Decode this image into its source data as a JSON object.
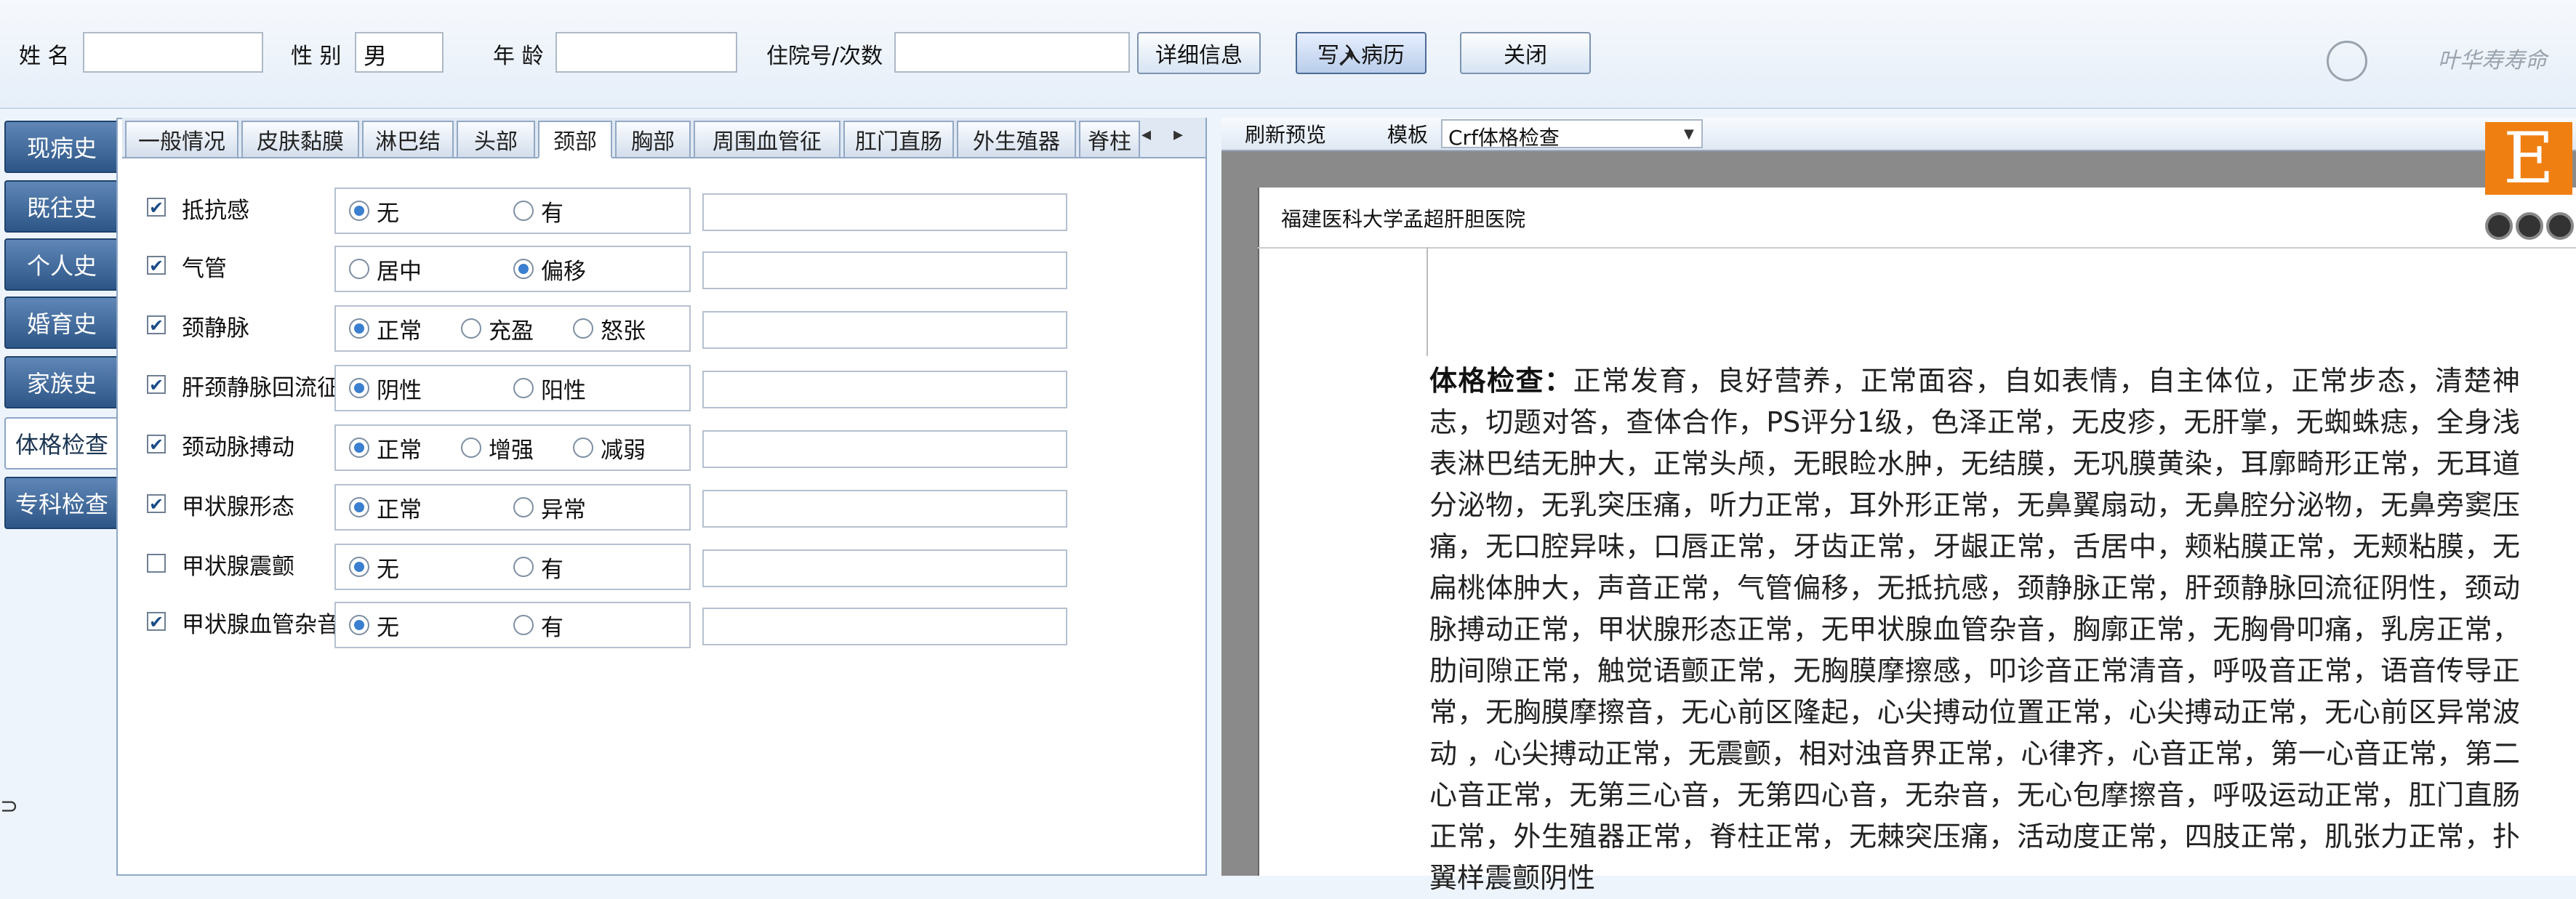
{
  "header": {
    "name_label": "姓 名",
    "name_value": "",
    "gender_label": "性 别",
    "gender_value": "男",
    "age_label": "年 龄",
    "age_value": "",
    "admission_label": "住院号/次数",
    "admission_value": "",
    "details_button": "详细信息",
    "write_record_button": "写入病历",
    "close_button": "关闭",
    "logo_text": "叶华寿寿命"
  },
  "side_tabs": [
    "现病史",
    "既往史",
    "个人史",
    "婚育史",
    "家族史",
    "体格检查",
    "专科检查"
  ],
  "side_tabs_active": "体格检查",
  "top_tabs": [
    "一般情况",
    "皮肤黏膜",
    "淋巴结",
    "头部",
    "颈部",
    "胸部",
    "周围血管征",
    "肛门直肠",
    "外生殖器",
    "脊柱"
  ],
  "top_tabs_active": "颈部",
  "top_tabs_nav": [
    "◂",
    "▸"
  ],
  "rows": [
    {
      "label": "抵抗感",
      "checked": true,
      "options": [
        {
          "text": "无",
          "selected": true
        },
        {
          "text": "有",
          "selected": false
        }
      ]
    },
    {
      "label": "气管",
      "checked": true,
      "options": [
        {
          "text": "居中",
          "selected": false
        },
        {
          "text": "偏移",
          "selected": true
        }
      ]
    },
    {
      "label": "颈静脉",
      "checked": true,
      "options": [
        {
          "text": "正常",
          "selected": true
        },
        {
          "text": "充盈",
          "selected": false
        },
        {
          "text": "怒张",
          "selected": false
        }
      ]
    },
    {
      "label": "肝颈静脉回流征",
      "checked": true,
      "options": [
        {
          "text": "阴性",
          "selected": true
        },
        {
          "text": "阳性",
          "selected": false
        }
      ]
    },
    {
      "label": "颈动脉搏动",
      "checked": true,
      "options": [
        {
          "text": "正常",
          "selected": true
        },
        {
          "text": "增强",
          "selected": false
        },
        {
          "text": "减弱",
          "selected": false
        }
      ]
    },
    {
      "label": "甲状腺形态",
      "checked": true,
      "options": [
        {
          "text": "正常",
          "selected": true
        },
        {
          "text": "异常",
          "selected": false
        }
      ]
    },
    {
      "label": "甲状腺震颤",
      "checked": false,
      "options": [
        {
          "text": "无",
          "selected": true
        },
        {
          "text": "有",
          "selected": false
        }
      ]
    },
    {
      "label": "甲状腺血管杂音",
      "checked": true,
      "options": [
        {
          "text": "无",
          "selected": true
        },
        {
          "text": "有",
          "selected": false
        }
      ]
    }
  ],
  "right_toolbar": {
    "refresh_label": "刷新预览",
    "template_label": "模板",
    "template_value": "Crf体格检查"
  },
  "document": {
    "hospital_name": "福建医科大学孟超肝胆医院",
    "exam_title": "体格检查：",
    "exam_body": "正常发育，良好营养，正常面容，自如表情，自主体位，正常步态，清楚神志，切题对答，查体合作，PS评分1级，色泽正常，无皮疹，无肝掌，无蜘蛛痣，全身浅表淋巴结无肿大，正常头颅，无眼睑水肿，无结膜，无巩膜黄染，耳廓畸形正常，无耳道分泌物，无乳突压痛，听力正常，耳外形正常，无鼻翼扇动，无鼻腔分泌物，无鼻旁窦压痛，无口腔异味，口唇正常，牙齿正常，牙龈正常，舌居中，颊粘膜正常，无颊粘膜，无扁桃体肿大，声音正常，气管偏移，无抵抗感，颈静脉正常，肝颈静脉回流征阴性，颈动脉搏动正常，甲状腺形态正常，无甲状腺血管杂音，胸廓正常，无胸骨叩痛，乳房正常，肋间隙正常，触觉语颤正常，无胸膜摩擦感，叩诊音正常清音，呼吸音正常，语音传导正常，无胸膜摩擦音，无心前区隆起，心尖搏动位置正常，心尖搏动正常，无心前区异常波动 ，心尖搏动正常，无震颤，相对浊音界正常，心律齐，心音正常，第一心音正常，第二心音正常，无第三心音，无第四心音，无杂音，无心包摩擦音，呼吸运动正常，肛门直肠正常，外生殖器正常，脊柱正常，无棘突压痛，活动度正常，四肢正常，肌张力正常，扑翼样震颤阴性"
  },
  "badge": {
    "letter": "E"
  },
  "colors": {
    "accent": "#2d5687",
    "badge": "#f07f12",
    "radio": "#3b7fd0"
  }
}
